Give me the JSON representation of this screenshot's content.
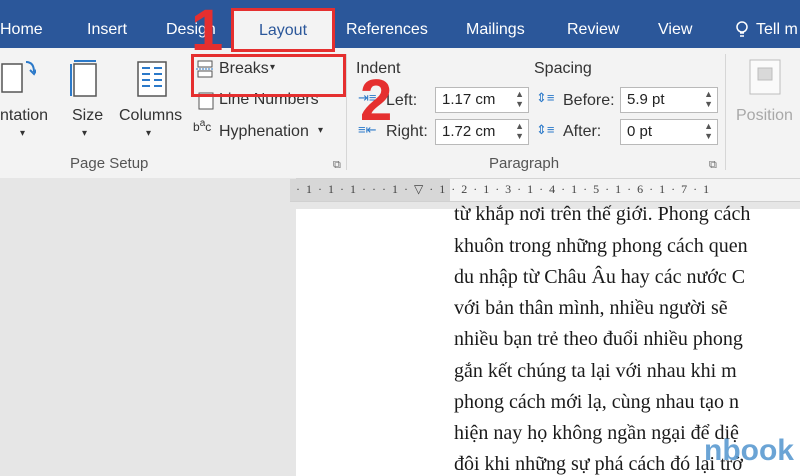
{
  "tabs": {
    "home": "Home",
    "insert": "Insert",
    "design": "Design",
    "layout": "Layout",
    "references": "References",
    "mailings": "Mailings",
    "review": "Review",
    "view": "View",
    "tell": "Tell m"
  },
  "page_setup": {
    "orientation": "ntation",
    "size": "Size",
    "columns": "Columns",
    "breaks": "Breaks",
    "line_numbers": "Line Numbers",
    "hyphenation": "Hyphenation",
    "group": "Page Setup"
  },
  "paragraph": {
    "indent_header": "Indent",
    "left_label": "Left:",
    "left_value": "1.17 cm",
    "right_label": "Right:",
    "right_value": "1.72 cm",
    "spacing_header": "Spacing",
    "before_label": "Before:",
    "before_value": "5.9 pt",
    "after_label": "After:",
    "after_value": "0 pt",
    "group": "Paragraph"
  },
  "arrange": {
    "position": "Position"
  },
  "ruler": {
    "text": "· 1 · 1 · 1 ·   ·   · 1 · ▽ · 1 · 2 · 1 · 3 · 1 · 4 · 1 · 5 · 1 · 6 · 1 · 7 · 1"
  },
  "document": {
    "lines": [
      "từ khắp nơi trên thế giới. Phong cách",
      "khuôn trong những phong cách quen",
      "du nhập từ Châu Âu hay các nước C",
      "với bản thân mình, nhiều người sẽ",
      "nhiều bạn trẻ theo đuổi nhiều phong",
      "gắn kết chúng ta lại với nhau khi m",
      "phong cách mới lạ, cùng nhau tạo n",
      "hiện nay họ không ngần ngại để diệ",
      "đôi khi những sự phá cách đó lại trở"
    ]
  },
  "annotations": {
    "step1": "1",
    "step2": "2"
  },
  "watermark": "nbook",
  "colors": {
    "tab_bar": "#2b579a",
    "highlight": "#e52f2f"
  }
}
